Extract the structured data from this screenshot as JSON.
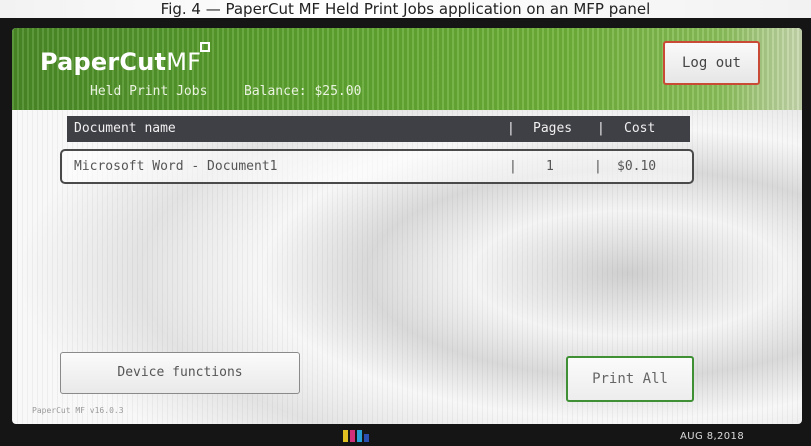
{
  "top_caption": "Fig. 4 — PaperCut MF Held Print Jobs application on an MFP panel",
  "app": {
    "logo_text": "PaperCut",
    "logo_suffix": "MF",
    "subtitle": "Held Print Jobs",
    "balance": "Balance: $25.00",
    "logout_label": "Log out",
    "version": "PaperCut MF v16.0.3"
  },
  "table": {
    "headers": {
      "name": "Document name",
      "sep1": "|",
      "pages": "Pages",
      "sep2": "|",
      "cost": "Cost"
    },
    "rows": [
      {
        "name": "Microsoft Word - Document1",
        "sep1": "|",
        "pages": "1",
        "sep2": "|",
        "cost": "$0.10"
      }
    ]
  },
  "buttons": {
    "device_functions": "Device functions",
    "print_all": "Print All"
  },
  "status_bar": {
    "date": "AUG  8,2018"
  },
  "colors": {
    "header_green": "#5ea52f",
    "logout_border": "#c94b35",
    "print_border": "#3f8f35",
    "table_header": "#3f3f46"
  }
}
